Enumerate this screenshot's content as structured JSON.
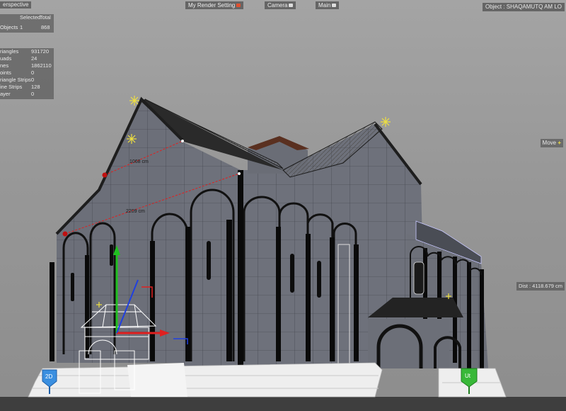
{
  "view": {
    "name": "erspective",
    "render_setting": "My Render Setting",
    "camera": "Camera",
    "layer": "Main"
  },
  "object_readout": "Object : SHAQAMUTQ AM LO",
  "selection_table": {
    "headers": [
      "Selected",
      "Total"
    ],
    "row_label": "Objects",
    "selected": "1",
    "total": "868"
  },
  "stats": [
    {
      "label": "riangles",
      "value": "931720"
    },
    {
      "label": "uads",
      "value": "24"
    },
    {
      "label": "nes",
      "value": "1862110"
    },
    {
      "label": "oints",
      "value": "0"
    },
    {
      "label": "riangle Strips",
      "value": "0"
    },
    {
      "label": "ine Strips",
      "value": "128"
    },
    {
      "label": "ayer",
      "value": "0"
    }
  ],
  "tool_label": "Move",
  "distance_readout": "Dist : 4118.679 cm",
  "measurements": {
    "upper": "1068 cm",
    "lower": "2209 cm"
  },
  "pins": {
    "left": "2D",
    "right": "Ut"
  },
  "colors": {
    "accent": "#f0e040",
    "measure_line": "#e02020",
    "pin_blue": "#3a8fe0",
    "pin_green": "#38b838",
    "axis_x": "#e02020",
    "axis_y": "#20c020",
    "axis_z": "#2040e0"
  },
  "icons": [
    "camera-icon",
    "render-icon",
    "move-plus-icon",
    "layer-icon"
  ]
}
